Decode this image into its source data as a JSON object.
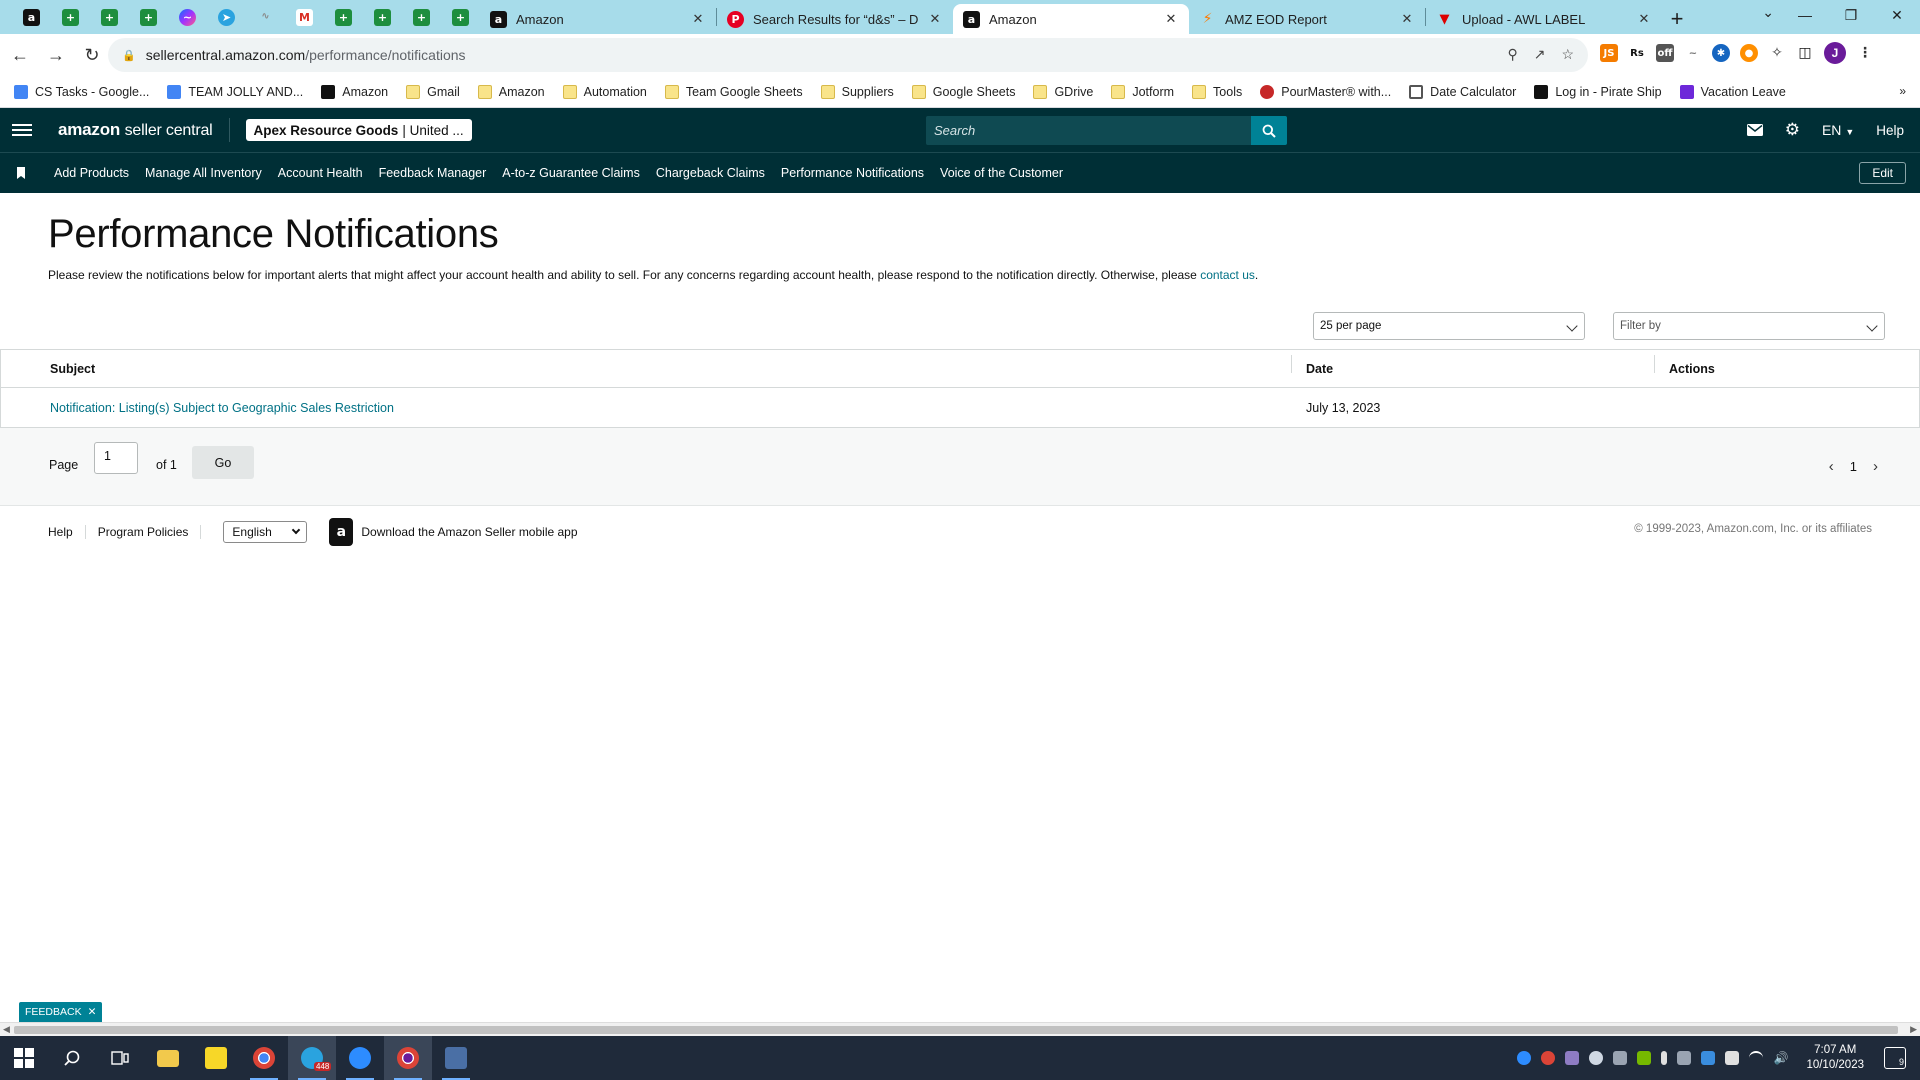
{
  "browser": {
    "tabs": [
      {
        "title": "Amazon",
        "icon": "amazon-icon",
        "active": false
      },
      {
        "title": "Search Results for “d&s” – Dow",
        "icon": "pinterest-icon",
        "active": false
      },
      {
        "title": "Amazon",
        "icon": "amazon-icon",
        "active": true
      },
      {
        "title": "AMZ EOD Report",
        "icon": "zapier-icon",
        "active": false
      },
      {
        "title": "Upload - AWL LABEL",
        "icon": "awl-icon",
        "active": false
      }
    ],
    "url_host": "sellercentral.amazon.com",
    "url_path": "/performance/notifications",
    "bookmarks": [
      {
        "label": "CS Tasks - Google...",
        "icon": "doc"
      },
      {
        "label": "TEAM JOLLY AND...",
        "icon": "doc"
      },
      {
        "label": "Amazon",
        "icon": "amz"
      },
      {
        "label": "Gmail",
        "icon": "folder"
      },
      {
        "label": "Amazon",
        "icon": "folder"
      },
      {
        "label": "Automation",
        "icon": "folder"
      },
      {
        "label": "Team Google Sheets",
        "icon": "folder"
      },
      {
        "label": "Suppliers",
        "icon": "folder"
      },
      {
        "label": "Google Sheets",
        "icon": "folder"
      },
      {
        "label": "GDrive",
        "icon": "folder"
      },
      {
        "label": "Jotform",
        "icon": "folder"
      },
      {
        "label": "Tools",
        "icon": "folder"
      },
      {
        "label": "PourMaster® with...",
        "icon": "pm"
      },
      {
        "label": "Date Calculator",
        "icon": "cal"
      },
      {
        "label": "Log in - Pirate Ship",
        "icon": "ps"
      },
      {
        "label": "Vacation Leave",
        "icon": "vl"
      }
    ],
    "bookmarks_more": "»"
  },
  "header": {
    "logo_brand": "amazon",
    "logo_sub": "seller central",
    "account_name": "Apex Resource Goods",
    "account_market": "| United ...",
    "search_placeholder": "Search",
    "language": "EN",
    "help": "Help"
  },
  "nav": {
    "items": [
      "Add Products",
      "Manage All Inventory",
      "Account Health",
      "Feedback Manager",
      "A-to-z Guarantee Claims",
      "Chargeback Claims",
      "Performance Notifications",
      "Voice of the Customer"
    ],
    "edit": "Edit"
  },
  "page": {
    "title": "Performance Notifications",
    "intro": "Please review the notifications below for important alerts that might affect your account health and ability to sell. For any concerns regarding account health, please respond to the notification directly. Otherwise, please ",
    "intro_link": "contact us",
    "intro_end": "."
  },
  "controls": {
    "per_page": "25 per page",
    "filter_placeholder": "Filter by"
  },
  "table": {
    "columns": [
      "Subject",
      "Date",
      "Actions"
    ],
    "rows": [
      {
        "subject": "Notification: Listing(s) Subject to Geographic Sales Restriction",
        "date": "July 13, 2023",
        "actions": ""
      }
    ]
  },
  "pagination": {
    "page_label": "Page",
    "current": "1",
    "of_label": "of 1",
    "go": "Go",
    "page_number": "1"
  },
  "footer": {
    "help": "Help",
    "policies": "Program Policies",
    "language": "English",
    "app": "Download the Amazon Seller mobile app",
    "copyright": "© 1999-2023, Amazon.com, Inc. or its affiliates"
  },
  "feedback": "FEEDBACK",
  "taskbar": {
    "time": "7:07 AM",
    "date": "10/10/2023",
    "telegram_badge": "448",
    "notifications": "9"
  },
  "colors": {
    "header_bg": "#002f36",
    "accent": "#008296",
    "link": "#007185",
    "tabstrip": "#a7dcea"
  }
}
